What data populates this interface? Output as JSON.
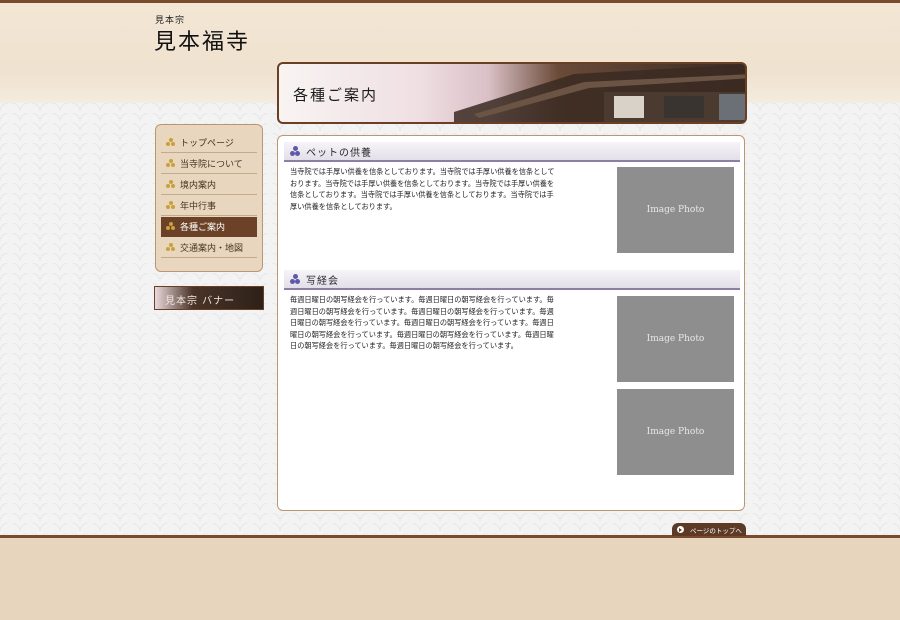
{
  "site": {
    "logo_small": "見本宗",
    "logo_main": "見本福寺"
  },
  "banner": {
    "title": "各種ご案内"
  },
  "nav": {
    "items": [
      {
        "label": "トップページ",
        "active": false
      },
      {
        "label": "当寺院について",
        "active": false
      },
      {
        "label": "境内案内",
        "active": false
      },
      {
        "label": "年中行事",
        "active": false
      },
      {
        "label": "各種ご案内",
        "active": true
      },
      {
        "label": "交通案内・地図",
        "active": false
      }
    ]
  },
  "side_banner": {
    "text": "見本宗 バナー"
  },
  "sections": [
    {
      "title": "ペットの供養",
      "text": "当寺院では手厚い供養を信条としております。当寺院では手厚い供養を信条としております。当寺院では手厚い供養を信条としております。当寺院では手厚い供養を信条としております。当寺院では手厚い供養を信条としております。当寺院では手厚い供養を信条としております。",
      "photos": [
        "Image Photo"
      ]
    },
    {
      "title": "写経会",
      "text": "毎週日曜日の朝写経会を行っています。毎週日曜日の朝写経会を行っています。毎週日曜日の朝写経会を行っています。毎週日曜日の朝写経会を行っています。毎週日曜日の朝写経会を行っています。毎週日曜日の朝写経会を行っています。毎週日曜日の朝写経会を行っています。毎週日曜日の朝写経会を行っています。毎週日曜日の朝写経会を行っています。毎週日曜日の朝写経会を行っています。",
      "photos": [
        "Image Photo",
        "Image Photo"
      ]
    }
  ],
  "pagetop": {
    "label": "ページのトップへ"
  },
  "colors": {
    "brown": "#6b4227",
    "accent_purple": "#5d5aa8",
    "footer": "#e7d6bd"
  }
}
